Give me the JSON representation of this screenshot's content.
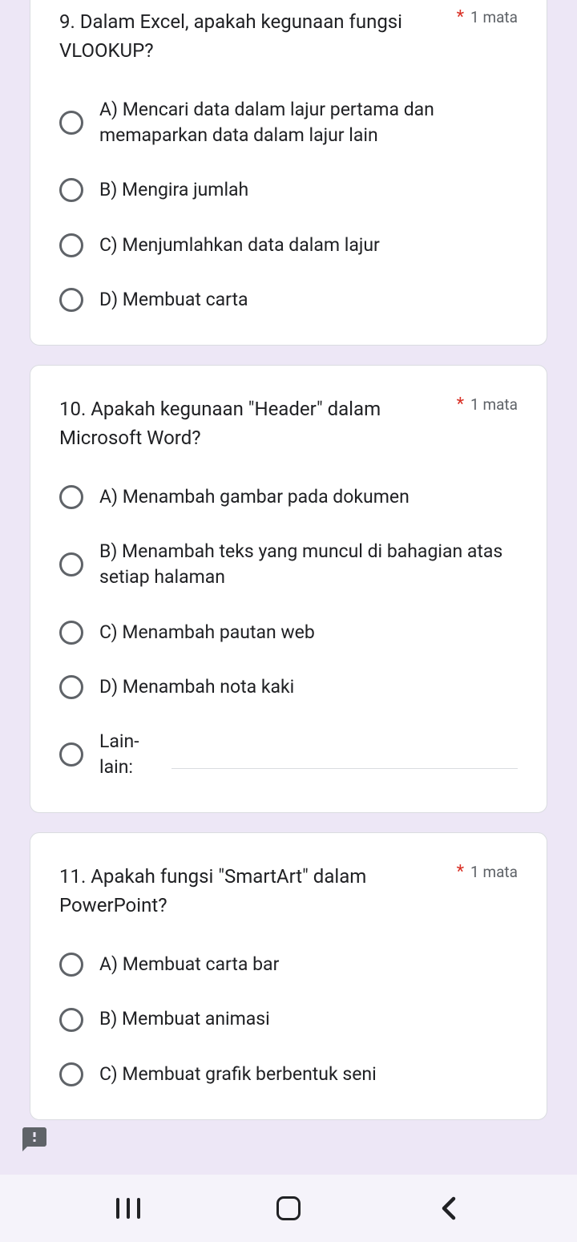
{
  "points_label": "1 mata",
  "questions": [
    {
      "title": "9. Dalam Excel, apakah kegunaan fungsi VLOOKUP?",
      "options": [
        "A) Mencari data dalam lajur pertama dan memaparkan data dalam lajur lain",
        "B) Mengira jumlah",
        "C) Menjumlahkan data dalam lajur",
        "D) Membuat carta"
      ]
    },
    {
      "title": "10. Apakah kegunaan \"Header\" dalam Microsoft Word?",
      "options": [
        "A) Menambah gambar pada dokumen",
        "B) Menambah teks yang muncul di bahagian atas setiap halaman",
        "C) Menambah pautan web",
        "D) Menambah nota kaki"
      ],
      "other_label": "Lain-lain:"
    },
    {
      "title": "11. Apakah fungsi \"SmartArt\" dalam PowerPoint?",
      "options": [
        "A) Membuat carta bar",
        "B) Membuat animasi",
        "C) Membuat grafik berbentuk seni"
      ]
    }
  ]
}
